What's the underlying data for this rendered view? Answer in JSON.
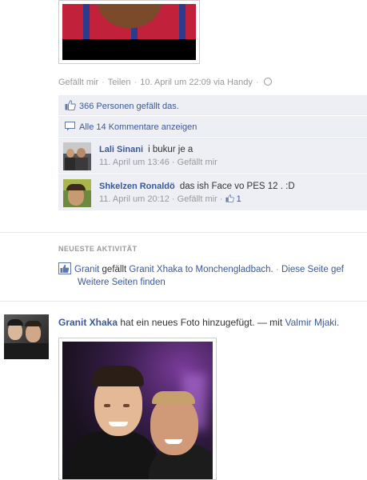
{
  "top_post": {
    "actions": {
      "like": "Gefällt mir",
      "share": "Teilen",
      "timestamp": "10. April um 22:09 via Handy"
    },
    "likes_summary": "366 Personen gefällt das.",
    "view_all_comments": "Alle 14 Kommentare anzeigen",
    "comments": [
      {
        "author": "Lali Sinani",
        "text": "i bukur je a",
        "time": "11. April um 13:46",
        "like_label": "Gefällt mir",
        "like_count": ""
      },
      {
        "author": "Shkelzen Ronaldö",
        "text": "das ish Face vo PES 12 . :D",
        "time": "11. April um 20:12",
        "like_label": "Gefällt mir",
        "like_count": "1"
      }
    ]
  },
  "recent_activity": {
    "title": "NEUESTE AKTIVITÄT",
    "actor": "Granit",
    "verb": "gefällt",
    "object": "Granit Xhaka to Monchengladbach.",
    "trailing": "Diese Seite gef",
    "more_pages": "Weitere Seiten finden"
  },
  "photo_post": {
    "author": "Granit Xhaka",
    "action": "hat ein neues Foto hinzugefügt. — mit",
    "tagged": "Valmir Mjaki."
  },
  "colors": {
    "link": "#3b5998",
    "ufi_background": "#edeff4",
    "meta_grey": "#999999"
  }
}
